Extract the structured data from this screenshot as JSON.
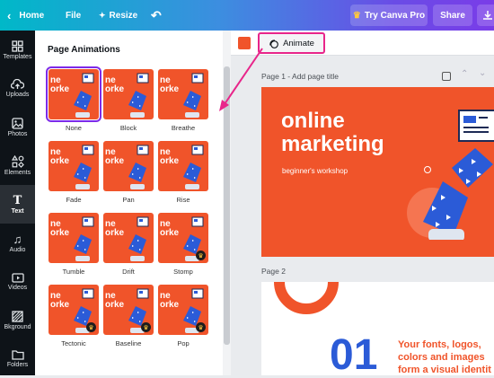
{
  "topbar": {
    "home_label": "Home",
    "file_label": "File",
    "resize_label": "Resize",
    "try_label": "Try Canva Pro",
    "share_label": "Share"
  },
  "rail": {
    "items": [
      {
        "label": "Templates",
        "icon": "grid-icon"
      },
      {
        "label": "Uploads",
        "icon": "cloud-upload-icon"
      },
      {
        "label": "Photos",
        "icon": "image-icon"
      },
      {
        "label": "Elements",
        "icon": "shapes-icon"
      },
      {
        "label": "Text",
        "icon": "text-icon"
      },
      {
        "label": "Audio",
        "icon": "music-icon"
      },
      {
        "label": "Videos",
        "icon": "video-icon"
      },
      {
        "label": "Bkground",
        "icon": "pattern-icon"
      },
      {
        "label": "Folders",
        "icon": "folder-icon"
      }
    ]
  },
  "panel": {
    "title": "Page Animations",
    "thumb_text": "ne\norke",
    "animations": [
      "None",
      "Block",
      "Breathe",
      "Fade",
      "Pan",
      "Rise",
      "Tumble",
      "Drift",
      "Stomp",
      "Tectonic",
      "Baseline",
      "Pop"
    ]
  },
  "toolbar": {
    "animate_label": "Animate",
    "color_swatch": "#f0542a"
  },
  "page1": {
    "header": "Page 1 - Add page title",
    "line1": "online",
    "line2": "marketing",
    "sub": "beginner's workshop"
  },
  "page2": {
    "header": "Page 2",
    "number": "01",
    "line1": "Your fonts, logos,",
    "line2": "colors and images",
    "line3": "form a visual identit"
  },
  "colors": {
    "accent": "#7d2ae8",
    "brand_orange": "#f0542a",
    "arrow": "#e8258a",
    "blue": "#2b5bd7"
  }
}
